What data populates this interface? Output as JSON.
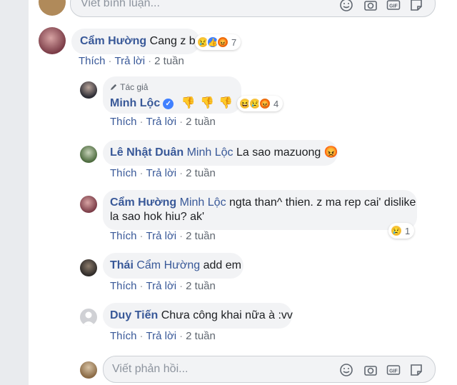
{
  "top_composer": {
    "placeholder": "Viết bình luận..."
  },
  "main_comment": {
    "author": "Cẩm Hường",
    "text": "Cang z bo",
    "reaction_count": "7",
    "actions": {
      "like": "Thích",
      "reply": "Trả lời",
      "time": "2 tuần"
    }
  },
  "replies": [
    {
      "author_tag": "Tác giả",
      "author": "Minh Lộc",
      "verified": true,
      "text": "👎 👎 👎 👎",
      "reaction_count": "4",
      "actions": {
        "like": "Thích",
        "reply": "Trả lời",
        "time": "2 tuần"
      }
    },
    {
      "author": "Lê Nhật Duân",
      "mention": "Minh Lộc",
      "text": "La sao mazuong 😡",
      "actions": {
        "like": "Thích",
        "reply": "Trả lời",
        "time": "2 tuần"
      }
    },
    {
      "author": "Cẩm Hường",
      "mention": "Minh Lộc",
      "text_line1": "ngta than^ thien. z ma rep cai' dislike",
      "text_line2": "la sao hok hiu? ak'",
      "reaction_count": "1",
      "actions": {
        "like": "Thích",
        "reply": "Trả lời",
        "time": "2 tuần"
      }
    },
    {
      "author": "Thái",
      "mention": "Cẩm Hường",
      "text": "add em",
      "actions": {
        "like": "Thích",
        "reply": "Trả lời",
        "time": "2 tuần"
      }
    },
    {
      "author": "Duy Tiến",
      "text": "Chưa công khai nữa à :vv",
      "actions": {
        "like": "Thích",
        "reply": "Trả lời",
        "time": "2 tuần"
      }
    }
  ],
  "reply_composer": {
    "placeholder": "Viết phản hồi..."
  },
  "colors": {
    "link": "#385898",
    "bubble": "#f2f3f5",
    "like_blue": "#4080ff",
    "angry": "#e9710f",
    "sad_yellow": "#f7c744"
  }
}
